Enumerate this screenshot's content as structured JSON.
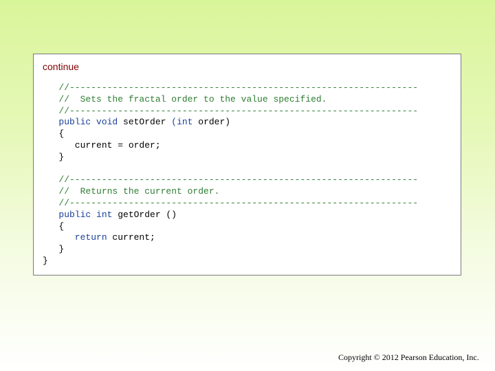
{
  "slide": {
    "continue_label": "continue",
    "footer": "Copyright © 2012 Pearson Education, Inc."
  },
  "code_lines": [
    [
      {
        "type": "comment",
        "text": "   //-----------------------------------------------------------------"
      }
    ],
    [
      {
        "type": "comment",
        "text": "   //  Sets the fractal order to the value specified."
      }
    ],
    [
      {
        "type": "comment",
        "text": "   //-----------------------------------------------------------------"
      }
    ],
    [
      {
        "type": "keyword",
        "text": "   public void "
      },
      {
        "type": "code",
        "text": "setOrder "
      },
      {
        "type": "keyword",
        "text": "("
      },
      {
        "type": "keyword",
        "text": "int "
      },
      {
        "type": "code",
        "text": "order)"
      }
    ],
    [
      {
        "type": "code",
        "text": "   {"
      }
    ],
    [
      {
        "type": "code",
        "text": "      current = order;"
      }
    ],
    [
      {
        "type": "code",
        "text": "   }"
      }
    ],
    [
      {
        "type": "code",
        "text": ""
      }
    ],
    [
      {
        "type": "comment",
        "text": "   //-----------------------------------------------------------------"
      }
    ],
    [
      {
        "type": "comment",
        "text": "   //  Returns the current order."
      }
    ],
    [
      {
        "type": "comment",
        "text": "   //-----------------------------------------------------------------"
      }
    ],
    [
      {
        "type": "keyword",
        "text": "   public int "
      },
      {
        "type": "code",
        "text": "getOrder ()"
      }
    ],
    [
      {
        "type": "code",
        "text": "   {"
      }
    ],
    [
      {
        "type": "keyword",
        "text": "      return "
      },
      {
        "type": "code",
        "text": "current;"
      }
    ],
    [
      {
        "type": "code",
        "text": "   }"
      }
    ],
    [
      {
        "type": "code",
        "text": "}"
      }
    ]
  ]
}
